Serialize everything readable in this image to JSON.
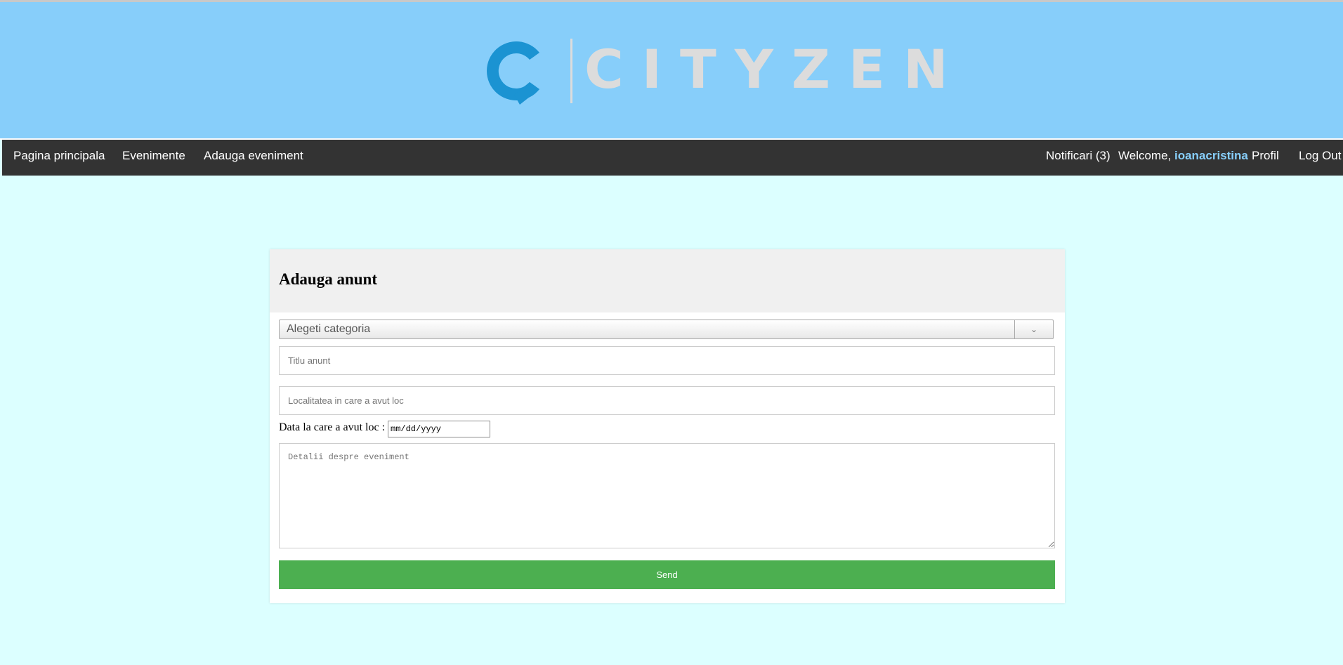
{
  "header": {
    "logo_text": "CITYZEN",
    "colors": {
      "header_bg": "#87cefa",
      "logo_blue": "#1b93d2",
      "logo_gray": "#dcdcdc"
    }
  },
  "nav": {
    "left_items": [
      "Pagina principala",
      "Evenimente",
      "Adauga eveniment"
    ],
    "notifications": "Notificari (3)",
    "welcome_prefix": "Welcome, ",
    "username": "ioanacristina",
    "profile": "Profil",
    "logout": "Log Out"
  },
  "form": {
    "title": "Adauga anunt",
    "category_select": {
      "selected": "Alegeti categoria",
      "icon": "chevron-down-icon"
    },
    "title_placeholder": "Titlu anunt",
    "location_placeholder": "Localitatea in care a avut loc",
    "date_label": "Data la care a avut loc :",
    "date_placeholder": "mm/dd/yyyy",
    "details_placeholder": "Detalii despre eveniment",
    "send_label": "Send",
    "colors": {
      "page_bg": "#dcffff",
      "send_bg": "#4caf50",
      "nav_bg": "#333333",
      "username": "#87cefa"
    }
  }
}
